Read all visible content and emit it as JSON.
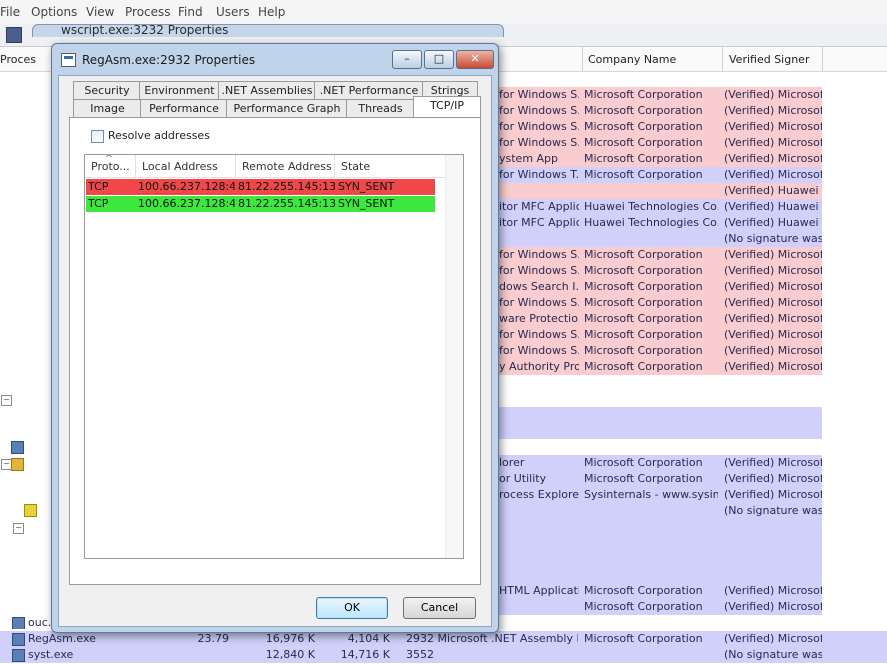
{
  "menu": [
    "File",
    "Options",
    "View",
    "Process",
    "Find",
    "Users",
    "Help"
  ],
  "process_explorer": {
    "columns": {
      "process": "Proces",
      "company": "Company Name",
      "signer": "Verified Signer"
    },
    "rows": [
      {
        "desc": "for Windows S...",
        "company": "Microsoft Corporation",
        "signer": "(Verified) Microsoft...",
        "color": "#f9cccf"
      },
      {
        "desc": "for Windows S...",
        "company": "Microsoft Corporation",
        "signer": "(Verified) Microsoft...",
        "color": "#f9cccf"
      },
      {
        "desc": "for Windows S...",
        "company": "Microsoft Corporation",
        "signer": "(Verified) Microsoft...",
        "color": "#f9cccf"
      },
      {
        "desc": "for Windows S...",
        "company": "Microsoft Corporation",
        "signer": "(Verified) Microsoft...",
        "color": "#f9cccf"
      },
      {
        "desc": "ystem App",
        "company": "Microsoft Corporation",
        "signer": "(Verified) Microsoft...",
        "color": "#f9cccf"
      },
      {
        "desc": "for Windows T...",
        "company": "Microsoft Corporation",
        "signer": "(Verified) Microsoft...",
        "color": "#d0d0fb"
      },
      {
        "desc": "",
        "company": "",
        "signer": "(Verified) Huawei ...",
        "color": "#f9cccf"
      },
      {
        "desc": "itor MFC Applic...",
        "company": "Huawei Technologies Co.,...",
        "signer": "(Verified) Huawei ...",
        "color": "#d0d0fb"
      },
      {
        "desc": "itor MFC Applic...",
        "company": "Huawei Technologies Co.,...",
        "signer": "(Verified) Huawei ...",
        "color": "#d0d0fb"
      },
      {
        "desc": "",
        "company": "",
        "signer": "(No signature was...",
        "color": "#d0d0fb"
      },
      {
        "desc": "for Windows S...",
        "company": "Microsoft Corporation",
        "signer": "(Verified) Microsoft...",
        "color": "#f9cccf"
      },
      {
        "desc": "for Windows S...",
        "company": "Microsoft Corporation",
        "signer": "(Verified) Microsoft...",
        "color": "#f9cccf"
      },
      {
        "desc": "dows Search I...",
        "company": "Microsoft Corporation",
        "signer": "(Verified) Microsoft...",
        "color": "#f9cccf"
      },
      {
        "desc": "for Windows S...",
        "company": "Microsoft Corporation",
        "signer": "(Verified) Microsoft...",
        "color": "#f9cccf"
      },
      {
        "desc": "ware Protectio...",
        "company": "Microsoft Corporation",
        "signer": "(Verified) Microsoft...",
        "color": "#f9cccf"
      },
      {
        "desc": "for Windows S...",
        "company": "Microsoft Corporation",
        "signer": "(Verified) Microsoft...",
        "color": "#f9cccf"
      },
      {
        "desc": "for Windows S...",
        "company": "Microsoft Corporation",
        "signer": "(Verified) Microsoft...",
        "color": "#f9cccf"
      },
      {
        "desc": "y Authority Proc...",
        "company": "Microsoft Corporation",
        "signer": "(Verified) Microsoft...",
        "color": "#f9cccf"
      },
      {
        "desc": "",
        "company": "",
        "signer": "",
        "color": "#ffffff"
      },
      {
        "desc": "",
        "company": "",
        "signer": "",
        "color": "#ffffff"
      },
      {
        "desc": "",
        "company": "",
        "signer": "",
        "color": "#d0d0fb"
      },
      {
        "desc": "",
        "company": "",
        "signer": "",
        "color": "#d0d0fb"
      },
      {
        "desc": "",
        "company": "",
        "signer": "",
        "color": "#ffffff"
      },
      {
        "desc": "lorer",
        "company": "Microsoft Corporation",
        "signer": "(Verified) Microsoft...",
        "color": "#d0d0fb"
      },
      {
        "desc": "or Utility",
        "company": "Microsoft Corporation",
        "signer": "(Verified) Microsoft...",
        "color": "#d0d0fb"
      },
      {
        "desc": "rocess Explorer",
        "company": "Sysinternals - www.sysinter...",
        "signer": "(Verified) Microsoft...",
        "color": "#d0d0fb"
      },
      {
        "desc": "",
        "company": "",
        "signer": "(No signature was...",
        "color": "#d0d0fb"
      },
      {
        "desc": "",
        "company": "",
        "signer": "",
        "color": "#d0d0fb"
      },
      {
        "desc": "",
        "company": "",
        "signer": "",
        "color": "#d0d0fb"
      },
      {
        "desc": "",
        "company": "",
        "signer": "",
        "color": "#d0d0fb"
      },
      {
        "desc": "",
        "company": "",
        "signer": "",
        "color": "#d0d0fb"
      },
      {
        "desc": "HTML Applicati...",
        "company": "Microsoft Corporation",
        "signer": "(Verified) Microsoft...",
        "color": "#d0d0fb"
      },
      {
        "desc": "",
        "company": "Microsoft Corporation",
        "signer": "(Verified) Microsoft...",
        "color": "#d0d0fb"
      },
      {
        "desc": "",
        "company": "",
        "signer": "",
        "color": "#ffffff"
      },
      {
        "desc": "",
        "company": "Microsoft Corporation",
        "signer": "(Verified) Microsoft...",
        "color": "#d0d0fb"
      },
      {
        "desc": "",
        "company": "",
        "signer": "(No signature was...",
        "color": "#d0d0fb"
      }
    ],
    "bottom_rows": [
      {
        "name": "ouc.e",
        "cpu": "",
        "private": "",
        "working": "",
        "pid_desc": "",
        "company": "",
        "signer": ""
      },
      {
        "name": "RegAsm.exe",
        "cpu": "23.79",
        "private": "16,976 K",
        "working": "4,104 K",
        "pid_desc": "2932 Microsoft .NET Assembly Re...",
        "company": "Microsoft Corporation",
        "signer": "(Verified) Microsoft..."
      },
      {
        "name": "syst.exe",
        "cpu": "",
        "private": "12,840 K",
        "working": "14,716 K",
        "pid_desc": "3552",
        "company": "",
        "signer": "(No signature was..."
      }
    ]
  },
  "back_window": {
    "title": "wscript.exe:3232 Properties"
  },
  "dialog": {
    "title": "RegAsm.exe:2932 Properties",
    "caption_buttons": {
      "minimize": "–",
      "maximize": "□",
      "close": "✕"
    },
    "tabs_row1": [
      "Security",
      "Environment",
      ".NET Assemblies",
      ".NET Performance",
      "Strings"
    ],
    "tabs_row2": [
      "Image",
      "Performance",
      "Performance Graph",
      "Threads",
      "TCP/IP"
    ],
    "selected_tab": "TCP/IP",
    "resolve_addresses": {
      "label": "Resolve addresses",
      "checked": false
    },
    "columns": [
      "Proto...",
      "Local Address",
      "Remote Address",
      "State"
    ],
    "sort_indicator": "^",
    "connections": [
      {
        "proto": "TCP",
        "local": "100.66.237.128:4...",
        "remote": "81.22.255.145:13...",
        "state": "SYN_SENT",
        "color": "#f04848"
      },
      {
        "proto": "TCP",
        "local": "100.66.237.128:4...",
        "remote": "81.22.255.145:13...",
        "state": "SYN_SENT",
        "color": "#3ce83c"
      }
    ],
    "ok_label": "OK",
    "cancel_label": "Cancel"
  }
}
